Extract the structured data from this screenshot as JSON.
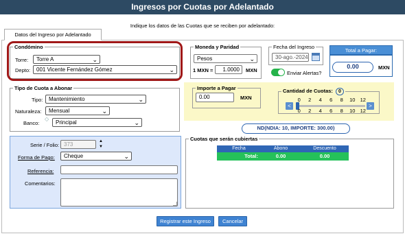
{
  "title": "Ingresos por Cuotas por Adelantado",
  "instruction": "Indique los datos de las Cuotas que se reciben por adelantado:",
  "tab": "Datos del Ingreso por Adelantado",
  "condominio": {
    "legend": "Condómino",
    "torre_label": "Torre:",
    "torre_value": "Torre A",
    "depto_label": "Depto:",
    "depto_value": "001 Vicente Fernández Gómez"
  },
  "moneda": {
    "legend": "Moneda y Paridad",
    "moneda_value": "Pesos",
    "paridad_label": "1 MXN  =",
    "paridad_value": "1.0000",
    "paridad_unit": "MXN"
  },
  "fecha": {
    "legend": "Fecha del Ingreso",
    "value": "30-ago.-2024",
    "alert_label": "Enviar Alertas?",
    "alert_on": true
  },
  "total": {
    "header": "Total a Pagar:",
    "value": "0.00",
    "unit": "MXN"
  },
  "tipo": {
    "legend": "Tipo de Cuota a Abonar",
    "tipo_label": "Tipo:",
    "tipo_value": "Mantenimiento",
    "naturaleza_label": "Naturaleza:",
    "naturaleza_value": "Mensual",
    "banco_label": "Banco:",
    "banco_value": "Principal"
  },
  "importe": {
    "legend": "Importe a Pagar",
    "value": "0.00",
    "unit": "MXN"
  },
  "cuotas": {
    "legend": "Cantidad de Cuotas:",
    "count": "0",
    "ticks": [
      "0",
      "2",
      "4",
      "6",
      "8",
      "10",
      "12"
    ],
    "left_arrow": "<",
    "right_arrow": ">"
  },
  "summary": "ND(NDIA: 10, IMPORTE: 300.00)",
  "datos": {
    "serie_label": "Serie / Folio:",
    "serie_value": "373",
    "forma_label": "Forma de Pago:",
    "forma_value": "Cheque",
    "referencia_label": "Referencia:",
    "referencia_value": "",
    "comentarios_label": "Comentarios:",
    "comentarios_value": ""
  },
  "cubiertas": {
    "legend": "Cuotas que serán cubiertas",
    "headers": [
      "Fecha",
      "Abono",
      "Descuento"
    ],
    "total_label": "Total:",
    "total_abono": "0.00",
    "total_descuento": "0.00"
  },
  "buttons": {
    "register": "Registrar este Ingreso",
    "cancel": "Cancelar"
  },
  "colors": {
    "title_bar": "#2d4a63",
    "accent_blue": "#4a8fd6",
    "highlight_red": "#a01818",
    "yellow_panel": "#fbf8c8",
    "blue_panel": "#dde8fb",
    "green_row": "#25c15a"
  }
}
